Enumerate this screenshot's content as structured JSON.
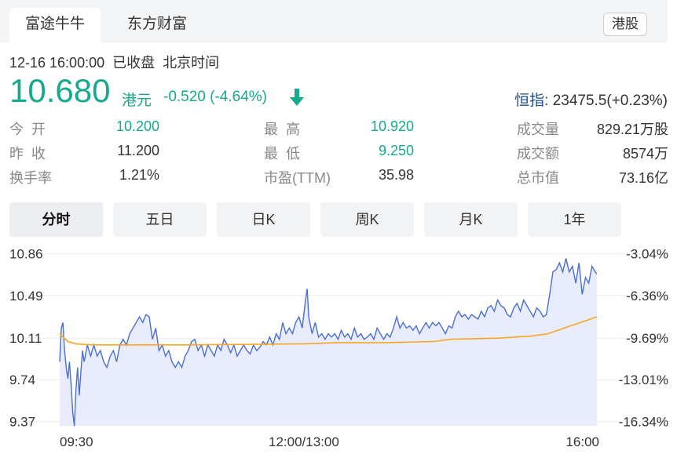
{
  "tabs": [
    {
      "label": "富途牛牛",
      "active": true
    },
    {
      "label": "东方财富",
      "active": false
    }
  ],
  "market_tag": "港股",
  "quote": {
    "timestamp": "12-16 16:00:00",
    "status": "已收盘",
    "timezone": "北京时间",
    "price": "10.680",
    "currency": "港元",
    "change": "-0.520 (-4.64%)",
    "direction": "down"
  },
  "index": {
    "label": "恒指:",
    "value": "23475.5(+0.23%)"
  },
  "stats": [
    {
      "label": "今  开",
      "value": "10.200",
      "color": "green"
    },
    {
      "label": "最  高",
      "value": "10.920",
      "color": "green"
    },
    {
      "label": "成交量",
      "value": "829.21万股",
      "color": "normal"
    },
    {
      "label": "昨  收",
      "value": "11.200",
      "color": "normal"
    },
    {
      "label": "最  低",
      "value": "9.250",
      "color": "green"
    },
    {
      "label": "成交额",
      "value": "8574万",
      "color": "normal"
    },
    {
      "label": "换手率",
      "value": "1.21%",
      "color": "normal"
    },
    {
      "label": "市盈(TTM)",
      "value": "35.98",
      "color": "normal"
    },
    {
      "label": "总市值",
      "value": "73.16亿",
      "color": "normal"
    }
  ],
  "period_tabs": [
    {
      "label": "分时",
      "active": true
    },
    {
      "label": "五日",
      "active": false
    },
    {
      "label": "日K",
      "active": false
    },
    {
      "label": "周K",
      "active": false
    },
    {
      "label": "月K",
      "active": false
    },
    {
      "label": "1年",
      "active": false
    }
  ],
  "colors": {
    "price_line": "#4a6fd0",
    "avg_line": "#f5a623",
    "fill": "#e4e9fb",
    "down": "#15a98d"
  },
  "chart_data": {
    "type": "line",
    "y_ticks": [
      "10.86",
      "10.49",
      "10.11",
      "9.74",
      "9.37"
    ],
    "y_tick_values": [
      10.86,
      10.49,
      10.11,
      9.74,
      9.37
    ],
    "pct_ticks": [
      "-3.04%",
      "-6.36%",
      "-9.69%",
      "-13.01%",
      "-16.34%"
    ],
    "x_ticks": [
      "09:30",
      "12:00/13:00",
      "16:00"
    ],
    "x_tick_positions": [
      0,
      150,
      330
    ],
    "ylim": [
      9.33,
      10.9
    ],
    "xlim": [
      0,
      330
    ],
    "series": [
      {
        "role": "price",
        "points": [
          [
            0,
            9.9
          ],
          [
            1,
            10.2
          ],
          [
            2,
            10.25
          ],
          [
            3,
            10.0
          ],
          [
            4,
            9.85
          ],
          [
            5,
            9.75
          ],
          [
            6,
            9.9
          ],
          [
            7,
            9.7
          ],
          [
            8,
            9.45
          ],
          [
            9,
            9.33
          ],
          [
            10,
            9.65
          ],
          [
            11,
            9.85
          ],
          [
            12,
            9.6
          ],
          [
            13,
            9.8
          ],
          [
            14,
            10.0
          ],
          [
            15,
            9.9
          ],
          [
            17,
            10.05
          ],
          [
            19,
            9.95
          ],
          [
            21,
            10.05
          ],
          [
            23,
            9.95
          ],
          [
            25,
            10.0
          ],
          [
            27,
            9.9
          ],
          [
            29,
            9.85
          ],
          [
            31,
            9.95
          ],
          [
            33,
            10.0
          ],
          [
            35,
            9.9
          ],
          [
            37,
            10.05
          ],
          [
            39,
            10.1
          ],
          [
            41,
            10.05
          ],
          [
            43,
            10.15
          ],
          [
            45,
            10.2
          ],
          [
            47,
            10.25
          ],
          [
            49,
            10.3
          ],
          [
            51,
            10.25
          ],
          [
            53,
            10.32
          ],
          [
            55,
            10.3
          ],
          [
            57,
            10.1
          ],
          [
            59,
            10.2
          ],
          [
            61,
            10.0
          ],
          [
            63,
            10.05
          ],
          [
            65,
            9.95
          ],
          [
            67,
            10.0
          ],
          [
            69,
            9.9
          ],
          [
            71,
            9.85
          ],
          [
            73,
            9.9
          ],
          [
            75,
            9.85
          ],
          [
            77,
            9.95
          ],
          [
            79,
            10.0
          ],
          [
            81,
            10.08
          ],
          [
            83,
            10.1
          ],
          [
            85,
            10.0
          ],
          [
            87,
            10.05
          ],
          [
            89,
            9.95
          ],
          [
            91,
            10.05
          ],
          [
            93,
            10.0
          ],
          [
            95,
            9.95
          ],
          [
            97,
            10.05
          ],
          [
            99,
            10.0
          ],
          [
            101,
            10.1
          ],
          [
            103,
            10.05
          ],
          [
            105,
            9.98
          ],
          [
            107,
            10.05
          ],
          [
            109,
            9.95
          ],
          [
            111,
            10.0
          ],
          [
            113,
            10.05
          ],
          [
            115,
            10.0
          ],
          [
            117,
            9.97
          ],
          [
            119,
            10.05
          ],
          [
            121,
            10.0
          ],
          [
            123,
            10.03
          ],
          [
            125,
            10.08
          ],
          [
            127,
            10.05
          ],
          [
            129,
            10.12
          ],
          [
            131,
            10.05
          ],
          [
            133,
            10.15
          ],
          [
            135,
            10.1
          ],
          [
            137,
            10.25
          ],
          [
            139,
            10.15
          ],
          [
            141,
            10.2
          ],
          [
            143,
            10.15
          ],
          [
            145,
            10.25
          ],
          [
            147,
            10.3
          ],
          [
            149,
            10.2
          ],
          [
            151,
            10.45
          ],
          [
            152,
            10.55
          ],
          [
            153,
            10.3
          ],
          [
            155,
            10.15
          ],
          [
            157,
            10.25
          ],
          [
            159,
            10.12
          ],
          [
            161,
            10.15
          ],
          [
            163,
            10.1
          ],
          [
            165,
            10.15
          ],
          [
            167,
            10.12
          ],
          [
            169,
            10.15
          ],
          [
            171,
            10.1
          ],
          [
            173,
            10.18
          ],
          [
            175,
            10.12
          ],
          [
            177,
            10.15
          ],
          [
            179,
            10.1
          ],
          [
            181,
            10.2
          ],
          [
            183,
            10.12
          ],
          [
            185,
            10.15
          ],
          [
            187,
            10.1
          ],
          [
            189,
            10.12
          ],
          [
            191,
            10.15
          ],
          [
            193,
            10.1
          ],
          [
            195,
            10.2
          ],
          [
            197,
            10.15
          ],
          [
            199,
            10.1
          ],
          [
            201,
            10.15
          ],
          [
            203,
            10.12
          ],
          [
            205,
            10.2
          ],
          [
            207,
            10.3
          ],
          [
            209,
            10.2
          ],
          [
            211,
            10.25
          ],
          [
            213,
            10.2
          ],
          [
            215,
            10.22
          ],
          [
            217,
            10.18
          ],
          [
            219,
            10.22
          ],
          [
            221,
            10.15
          ],
          [
            223,
            10.2
          ],
          [
            225,
            10.25
          ],
          [
            227,
            10.2
          ],
          [
            229,
            10.25
          ],
          [
            231,
            10.22
          ],
          [
            233,
            10.25
          ],
          [
            235,
            10.2
          ],
          [
            237,
            10.15
          ],
          [
            239,
            10.22
          ],
          [
            241,
            10.2
          ],
          [
            243,
            10.3
          ],
          [
            245,
            10.35
          ],
          [
            247,
            10.3
          ],
          [
            249,
            10.32
          ],
          [
            251,
            10.28
          ],
          [
            253,
            10.32
          ],
          [
            255,
            10.3
          ],
          [
            257,
            10.28
          ],
          [
            259,
            10.35
          ],
          [
            261,
            10.3
          ],
          [
            263,
            10.38
          ],
          [
            265,
            10.4
          ],
          [
            267,
            10.35
          ],
          [
            269,
            10.45
          ],
          [
            271,
            10.4
          ],
          [
            273,
            10.38
          ],
          [
            275,
            10.32
          ],
          [
            277,
            10.3
          ],
          [
            279,
            10.38
          ],
          [
            281,
            10.42
          ],
          [
            283,
            10.35
          ],
          [
            285,
            10.45
          ],
          [
            287,
            10.4
          ],
          [
            289,
            10.35
          ],
          [
            291,
            10.3
          ],
          [
            293,
            10.38
          ],
          [
            295,
            10.35
          ],
          [
            297,
            10.3
          ],
          [
            299,
            10.32
          ],
          [
            301,
            10.5
          ],
          [
            303,
            10.7
          ],
          [
            305,
            10.72
          ],
          [
            307,
            10.78
          ],
          [
            309,
            10.7
          ],
          [
            311,
            10.82
          ],
          [
            313,
            10.7
          ],
          [
            315,
            10.75
          ],
          [
            317,
            10.6
          ],
          [
            319,
            10.78
          ],
          [
            321,
            10.5
          ],
          [
            323,
            10.65
          ],
          [
            325,
            10.6
          ],
          [
            327,
            10.75
          ],
          [
            329,
            10.7
          ],
          [
            330,
            10.68
          ]
        ]
      },
      {
        "role": "average",
        "points": [
          [
            0,
            10.15
          ],
          [
            5,
            10.08
          ],
          [
            10,
            10.06
          ],
          [
            20,
            10.05
          ],
          [
            40,
            10.05
          ],
          [
            80,
            10.05
          ],
          [
            150,
            10.06
          ],
          [
            170,
            10.07
          ],
          [
            200,
            10.07
          ],
          [
            230,
            10.08
          ],
          [
            240,
            10.1
          ],
          [
            270,
            10.11
          ],
          [
            290,
            10.13
          ],
          [
            300,
            10.15
          ],
          [
            310,
            10.2
          ],
          [
            320,
            10.25
          ],
          [
            330,
            10.3
          ]
        ]
      }
    ]
  }
}
